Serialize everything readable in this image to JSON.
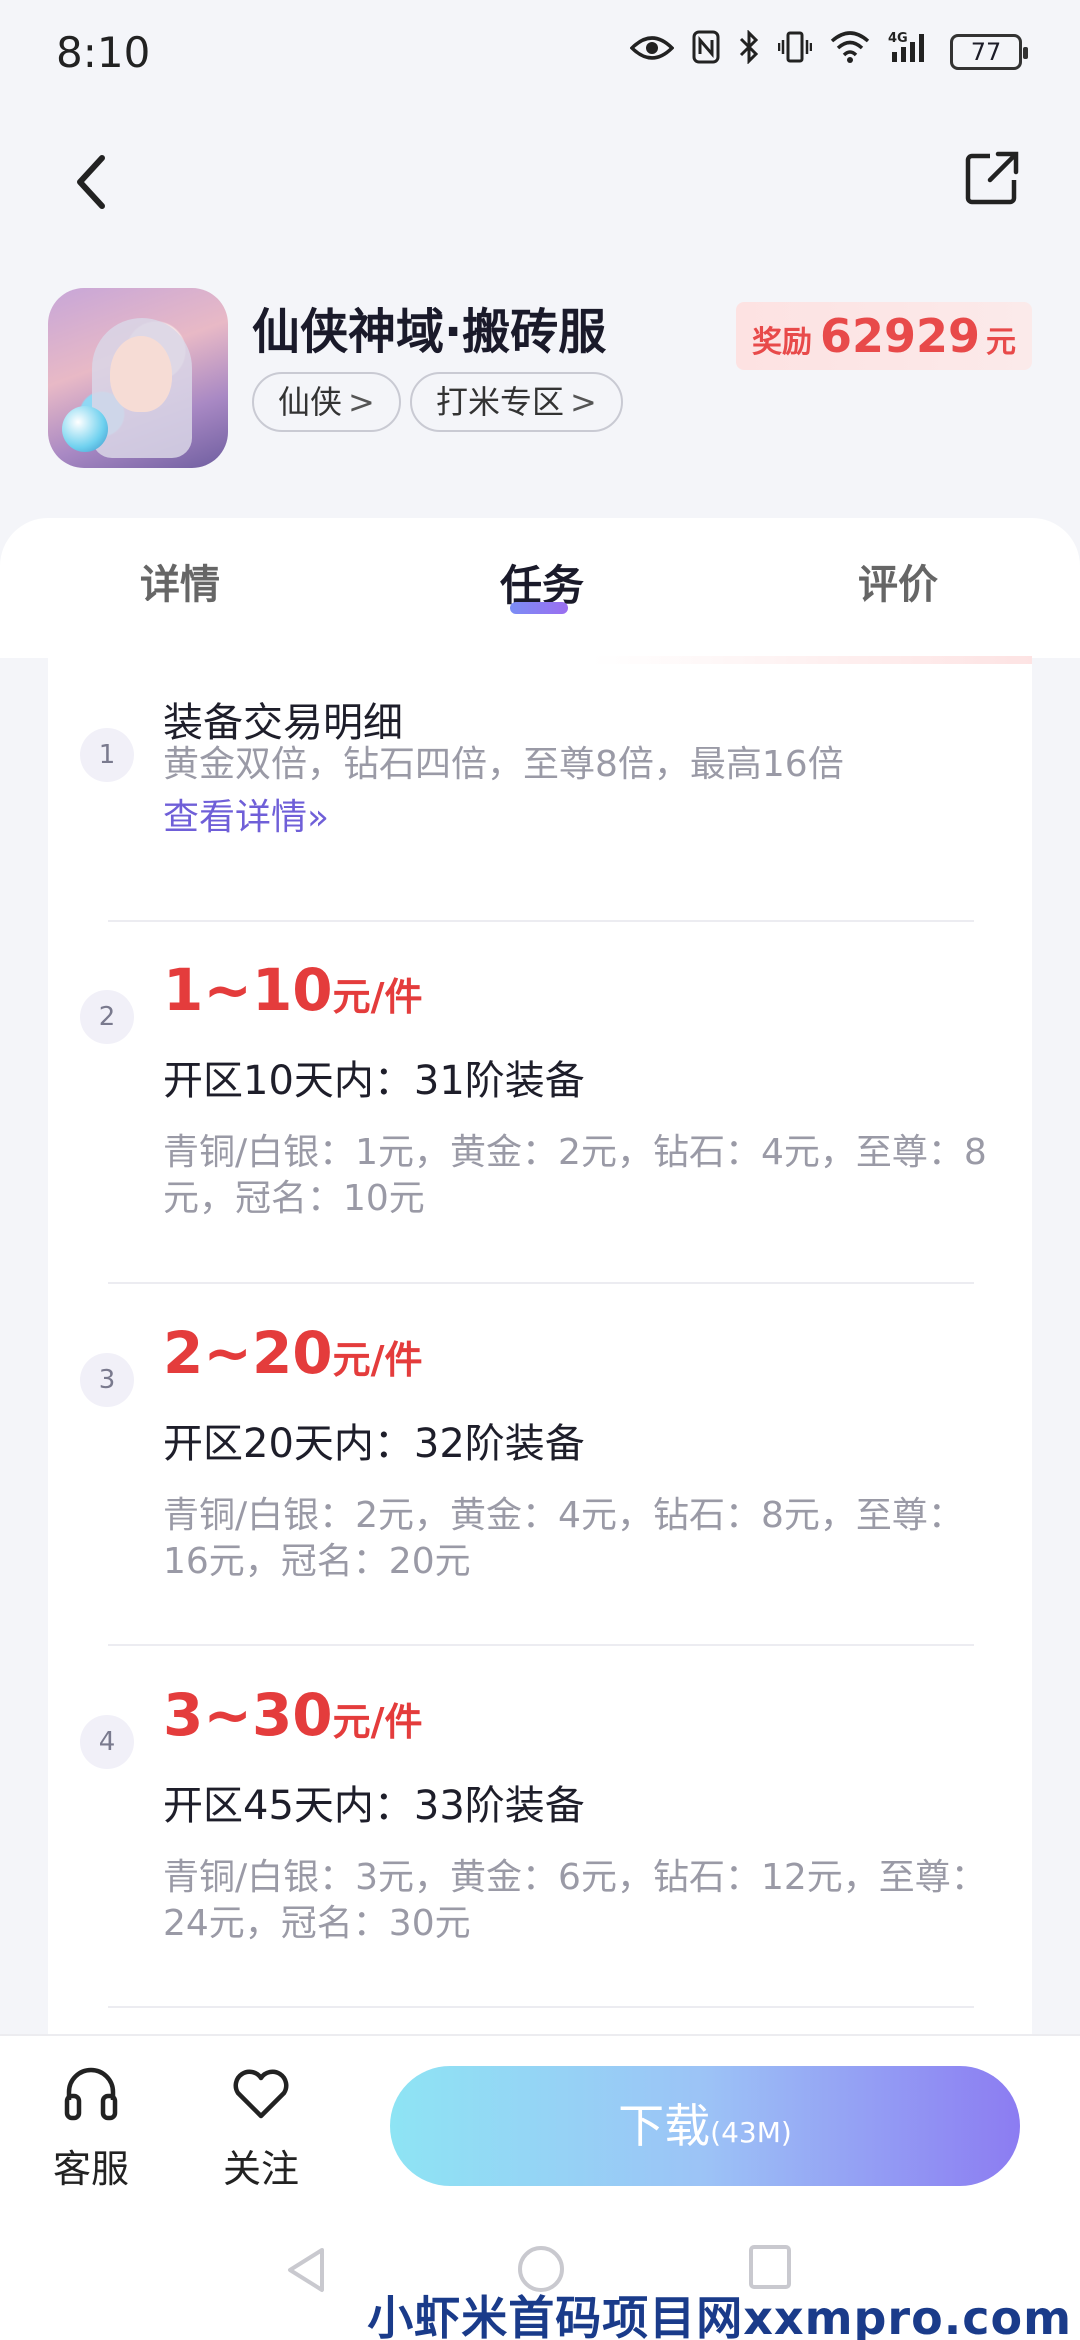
{
  "status": {
    "time": "8:10",
    "battery": "77",
    "network": "4G"
  },
  "app": {
    "title": "仙侠神域·搬砖服",
    "tags": [
      "仙侠",
      "打米专区"
    ],
    "reward_label": "奖励",
    "reward_amount": "62929",
    "reward_unit": "元"
  },
  "tabs": [
    {
      "label": "详情",
      "active": false
    },
    {
      "label": "任务",
      "active": true
    },
    {
      "label": "评价",
      "active": false
    }
  ],
  "steps": [
    {
      "num": "1",
      "title": "装备交易明细",
      "desc": "黄金双倍，钻石四倍，至尊8倍，最高16倍",
      "link": "查看详情»"
    },
    {
      "num": "2",
      "price": "1~10",
      "price_unit": "元/件",
      "title": "开区10天内：31阶装备",
      "desc": "青铜/白银：1元，黄金：2元，钻石：4元，至尊：8元，冠名：10元"
    },
    {
      "num": "3",
      "price": "2~20",
      "price_unit": "元/件",
      "title": "开区20天内：32阶装备",
      "desc": "青铜/白银：2元，黄金：4元，钻石：8元，至尊：16元，冠名：20元"
    },
    {
      "num": "4",
      "price": "3~30",
      "price_unit": "元/件",
      "title": "开区45天内：33阶装备",
      "desc": "青铜/白银：3元，黄金：6元，钻石：12元，至尊：24元，冠名：30元"
    }
  ],
  "bottom": {
    "service_label": "客服",
    "follow_label": "关注",
    "download_label": "下载",
    "download_size": "(43M)"
  },
  "watermark": "小虾米首码项目网xxmpro.com",
  "colors": {
    "accent_red": "#e43c3c",
    "link_purple": "#6f5fd8",
    "button_gradient_start": "#8ee4f4",
    "button_gradient_end": "#8c7cf2"
  }
}
